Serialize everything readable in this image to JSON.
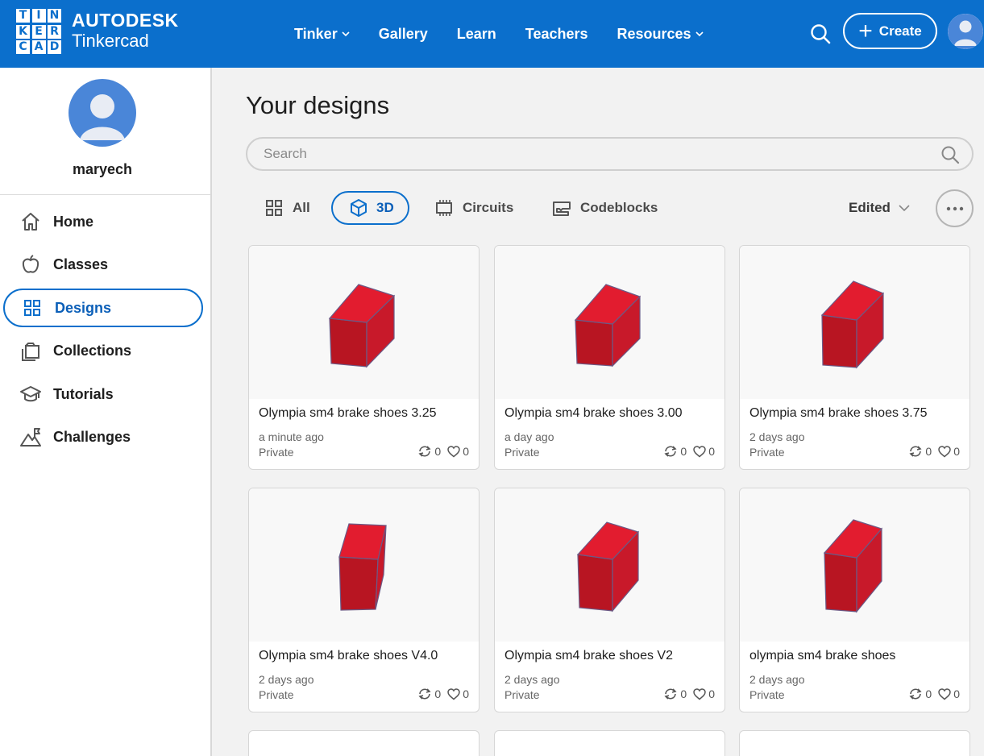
{
  "header": {
    "logo_letters": [
      "T",
      "I",
      "N",
      "K",
      "E",
      "R",
      "C",
      "A",
      "D"
    ],
    "brand_line1": "AUTODESK",
    "brand_line2": "Tinkercad",
    "nav": [
      {
        "label": "Tinker",
        "has_dropdown": true
      },
      {
        "label": "Gallery",
        "has_dropdown": false
      },
      {
        "label": "Learn",
        "has_dropdown": false
      },
      {
        "label": "Teachers",
        "has_dropdown": false
      },
      {
        "label": "Resources",
        "has_dropdown": true
      }
    ],
    "create_label": "Create",
    "accent_color": "#0b6fcc"
  },
  "sidebar": {
    "username": "maryech",
    "items": [
      {
        "label": "Home",
        "icon": "home-icon"
      },
      {
        "label": "Classes",
        "icon": "apple-icon"
      },
      {
        "label": "Designs",
        "icon": "grid-icon",
        "active": true
      },
      {
        "label": "Collections",
        "icon": "collections-icon"
      },
      {
        "label": "Tutorials",
        "icon": "graduation-cap-icon"
      },
      {
        "label": "Challenges",
        "icon": "mountain-flag-icon"
      }
    ]
  },
  "main": {
    "title": "Your designs",
    "search_placeholder": "Search",
    "filters": [
      {
        "label": "All",
        "icon": "grid-icon"
      },
      {
        "label": "3D",
        "icon": "cube-icon",
        "active": true
      },
      {
        "label": "Circuits",
        "icon": "chip-icon"
      },
      {
        "label": "Codeblocks",
        "icon": "codeblocks-icon"
      }
    ],
    "sort_label": "Edited"
  },
  "designs": [
    {
      "title": "Olympia sm4 brake shoes 3.25",
      "time": "a minute ago",
      "privacy": "Private",
      "remixes": "0",
      "likes": "0"
    },
    {
      "title": "Olympia sm4 brake shoes 3.00",
      "time": "a day ago",
      "privacy": "Private",
      "remixes": "0",
      "likes": "0"
    },
    {
      "title": "Olympia sm4 brake shoes 3.75",
      "time": "2 days ago",
      "privacy": "Private",
      "remixes": "0",
      "likes": "0"
    },
    {
      "title": "Olympia sm4 brake shoes V4.0",
      "time": "2 days ago",
      "privacy": "Private",
      "remixes": "0",
      "likes": "0"
    },
    {
      "title": "Olympia sm4 brake shoes V2",
      "time": "2 days ago",
      "privacy": "Private",
      "remixes": "0",
      "likes": "0"
    },
    {
      "title": "olympia sm4 brake shoes",
      "time": "2 days ago",
      "privacy": "Private",
      "remixes": "0",
      "likes": "0"
    }
  ],
  "colors": {
    "box_top": "#e21c2f",
    "box_front": "#b81522",
    "box_side": "#c8192a"
  }
}
